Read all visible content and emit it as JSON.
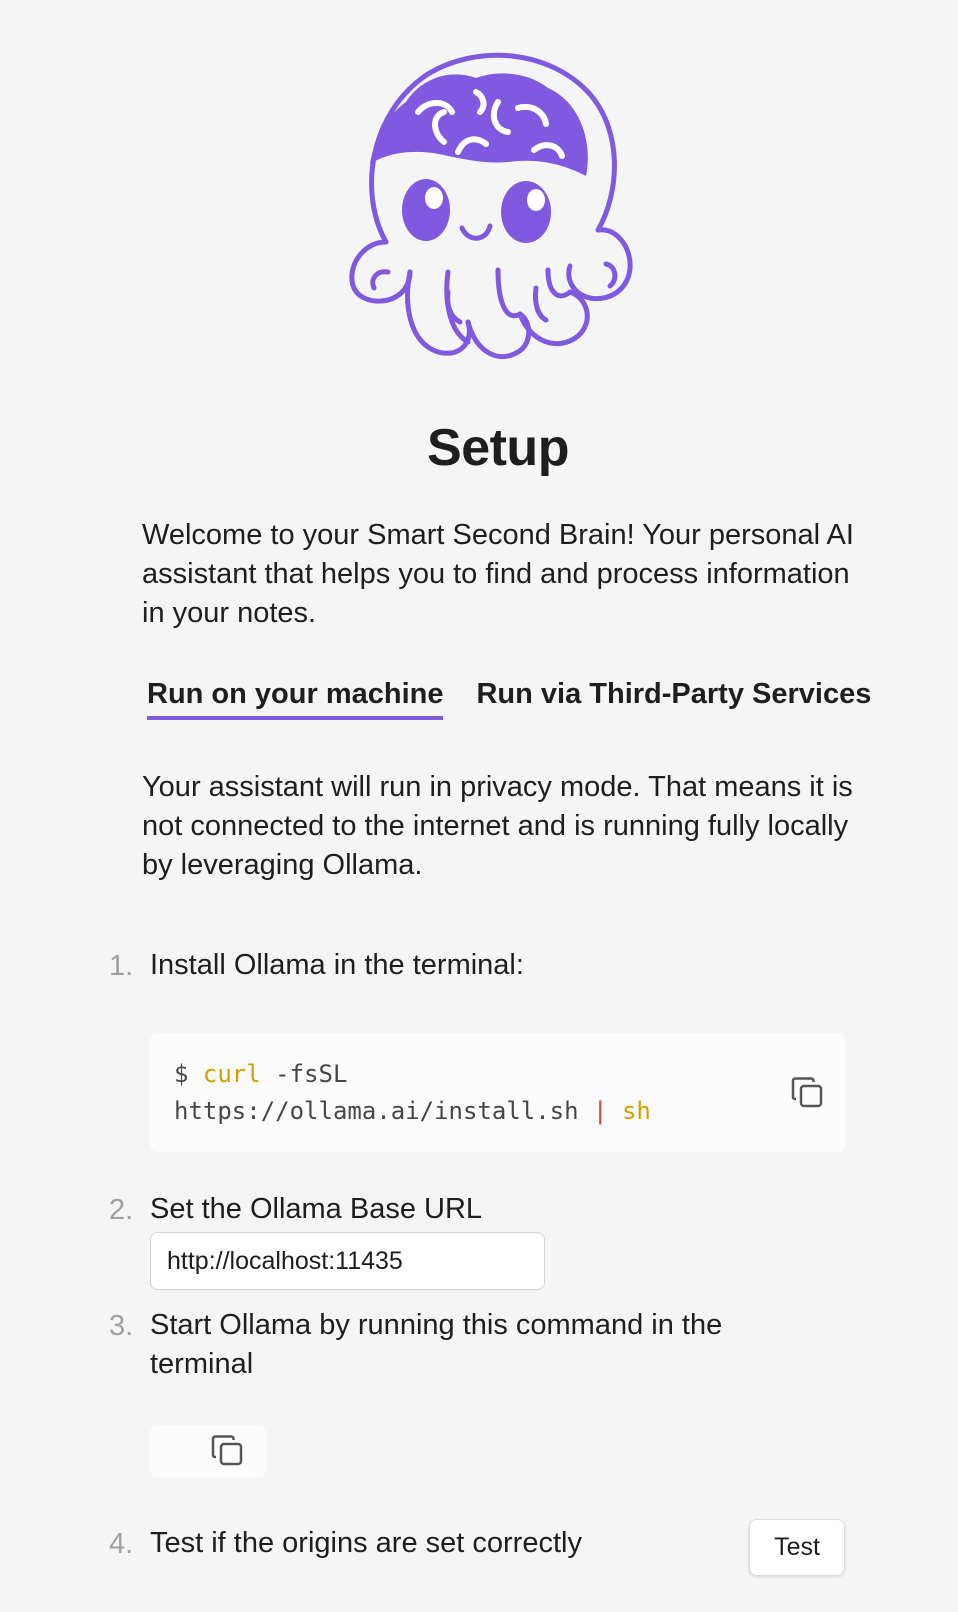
{
  "colors": {
    "accent": "#7f5ae0",
    "background": "#f5f5f5",
    "text": "#1e1e1e",
    "muted_number": "#a0a0a0",
    "code_keyword": "#d4a000",
    "code_pipe": "#e03a3a"
  },
  "logo": {
    "icon": "octopus-brain-logo"
  },
  "title": "Setup",
  "welcome": "Welcome to your Smart Second Brain! Your personal AI assistant that helps you to find and process information in your notes.",
  "tabs": [
    {
      "label": "Run on your machine",
      "active": true
    },
    {
      "label": "Run via Third-Party Services",
      "active": false
    }
  ],
  "privacy_text": "Your assistant will run in privacy mode. That means it is not connected to the internet and is running fully locally by leveraging Ollama.",
  "steps": [
    {
      "number": "1.",
      "text": "Install Ollama in the terminal:",
      "code": {
        "prompt": "$",
        "command": "curl",
        "flag": "-fsSL",
        "url": "https://ollama.ai/install.sh",
        "pipe": "|",
        "shell": "sh"
      },
      "copy_icon": "copy-icon"
    },
    {
      "number": "2.",
      "text": "Set the Ollama Base URL",
      "input_value": "http://localhost:11435"
    },
    {
      "number": "3.",
      "text": "Start Ollama by running this command in the terminal",
      "copy_icon": "copy-icon"
    },
    {
      "number": "4.",
      "text": "Test if the origins are set correctly",
      "button_label": "Test"
    }
  ]
}
